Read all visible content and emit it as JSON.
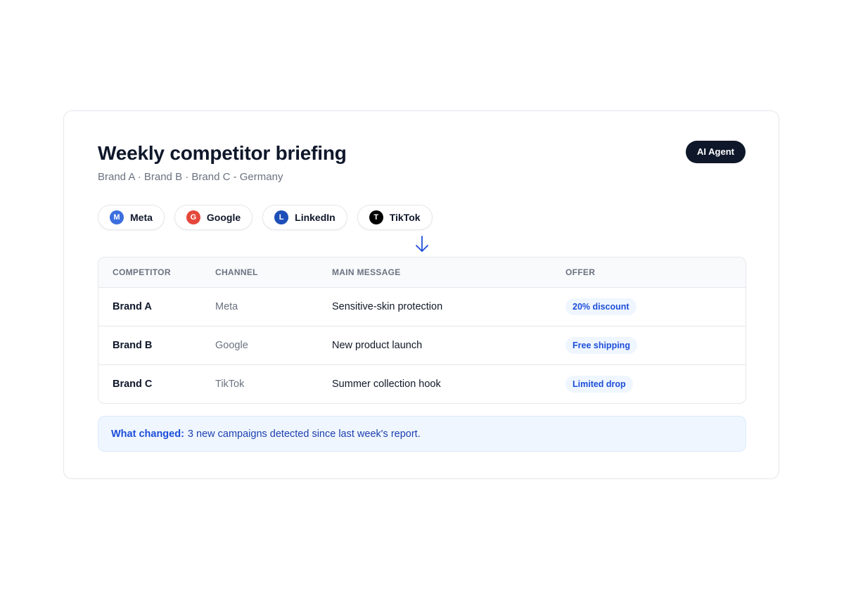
{
  "header": {
    "title": "Weekly competitor briefing",
    "subtitle": "Brand A · Brand B · Brand C - Germany",
    "badge": "AI Agent"
  },
  "channels": [
    {
      "label": "Meta",
      "icon_letter": "M",
      "icon": "meta-icon",
      "color": "#3b6fe0"
    },
    {
      "label": "Google",
      "icon_letter": "G",
      "icon": "google-icon",
      "color": "#e5483b"
    },
    {
      "label": "LinkedIn",
      "icon_letter": "L",
      "icon": "linkedin-icon",
      "color": "#1e4fb8"
    },
    {
      "label": "TikTok",
      "icon_letter": "T",
      "icon": "tiktok-icon",
      "color": "#000000"
    }
  ],
  "table": {
    "columns": [
      "COMPETITOR",
      "CHANNEL",
      "MAIN MESSAGE",
      "OFFER"
    ],
    "rows": [
      {
        "competitor": "Brand A",
        "channel": "Meta",
        "message": "Sensitive-skin protection",
        "offer": "20% discount"
      },
      {
        "competitor": "Brand B",
        "channel": "Google",
        "message": "New product launch",
        "offer": "Free shipping"
      },
      {
        "competitor": "Brand C",
        "channel": "TikTok",
        "message": "Summer collection hook",
        "offer": "Limited drop"
      }
    ]
  },
  "note": {
    "label": "What changed:",
    "text": "3 new campaigns detected since last week's report."
  },
  "colors": {
    "accent": "#1d4ed8",
    "badge_bg": "#0f172a",
    "offer_bg": "#eff6ff",
    "note_bg": "#eff6ff"
  }
}
